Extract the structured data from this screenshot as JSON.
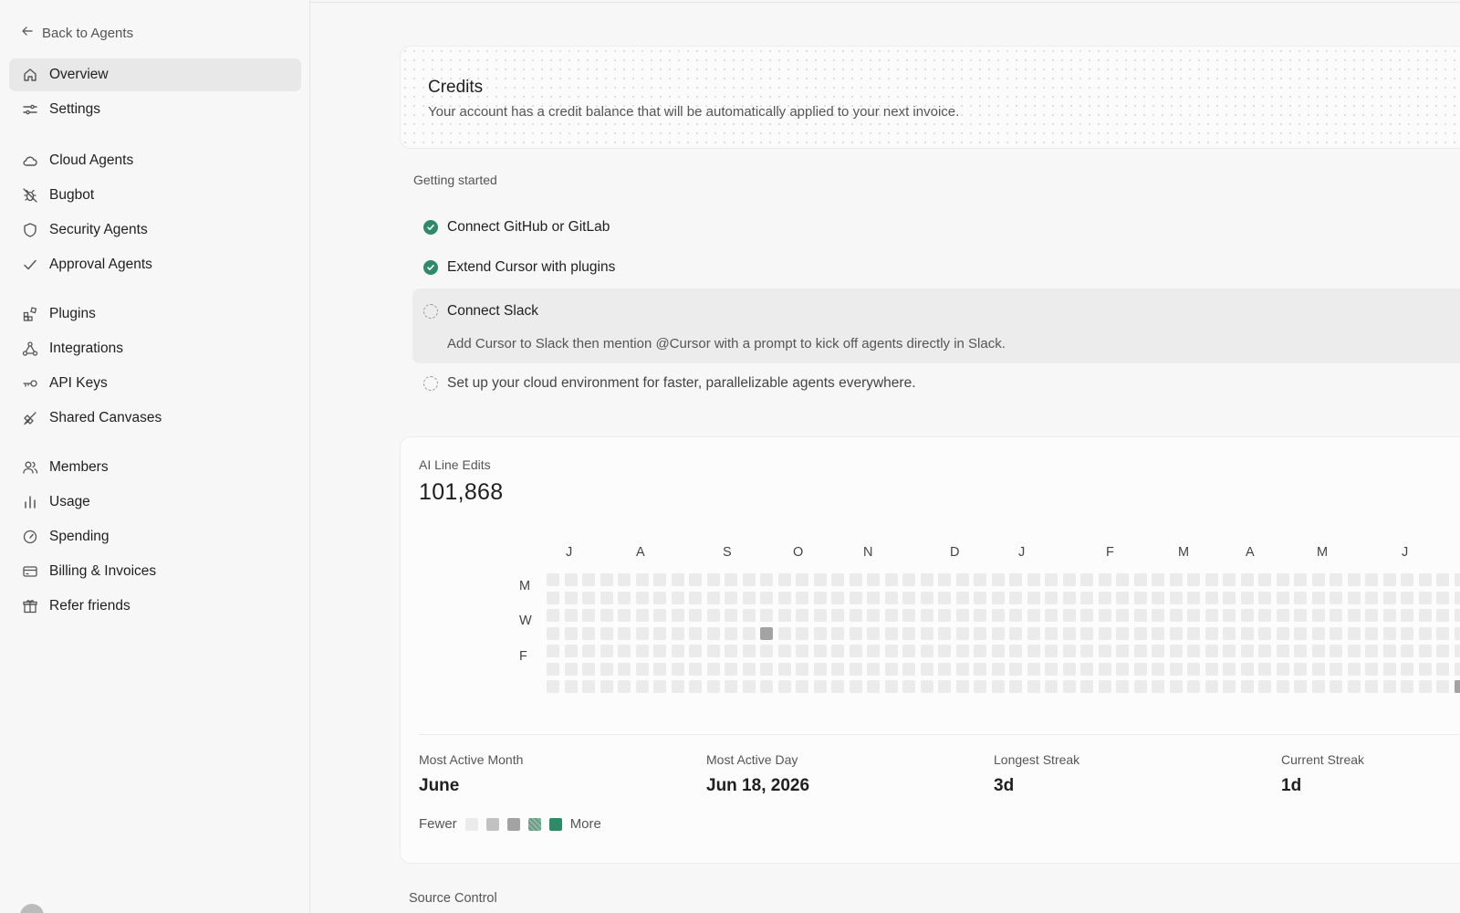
{
  "sidebar": {
    "back_label": "Back to Agents",
    "groups": [
      [
        {
          "label": "Overview",
          "icon": "home-icon",
          "active": true
        },
        {
          "label": "Settings",
          "icon": "sliders-icon"
        }
      ],
      [
        {
          "label": "Cloud Agents",
          "icon": "cloud-icon"
        },
        {
          "label": "Bugbot",
          "icon": "bug-off-icon"
        },
        {
          "label": "Security Agents",
          "icon": "shield-icon"
        },
        {
          "label": "Approval Agents",
          "icon": "check-icon"
        }
      ],
      [
        {
          "label": "Plugins",
          "icon": "plugin-blocks-icon"
        },
        {
          "label": "Integrations",
          "icon": "network-icon"
        },
        {
          "label": "API Keys",
          "icon": "key-icon"
        },
        {
          "label": "Shared Canvases",
          "icon": "brush-icon"
        }
      ],
      [
        {
          "label": "Members",
          "icon": "users-icon"
        },
        {
          "label": "Usage",
          "icon": "bar-chart-icon"
        },
        {
          "label": "Spending",
          "icon": "gauge-icon"
        },
        {
          "label": "Billing & Invoices",
          "icon": "credit-card-icon"
        },
        {
          "label": "Refer friends",
          "icon": "gift-icon"
        }
      ]
    ]
  },
  "credits": {
    "title": "Credits",
    "description": "Your account has a credit balance that will be automatically applied to your next invoice."
  },
  "getting_started": {
    "label": "Getting started",
    "items": [
      {
        "label": "Connect GitHub or GitLab",
        "done": true
      },
      {
        "label": "Extend Cursor with plugins",
        "done": true
      }
    ],
    "slack": {
      "label": "Connect Slack",
      "description": "Add Cursor to Slack then mention @Cursor with a prompt to kick off agents directly in Slack."
    },
    "cloud_env": "Set up your cloud environment for faster, parallelizable agents everywhere."
  },
  "ai_line_edits": {
    "label": "AI Line Edits",
    "value": "101,868",
    "months": [
      "J",
      "A",
      "S",
      "O",
      "N",
      "D",
      "J",
      "F",
      "M",
      "A",
      "M",
      "J"
    ],
    "days": [
      "M",
      "W",
      "F"
    ],
    "highlights": [
      {
        "week": 12,
        "day": 3,
        "level": 2
      },
      {
        "week": 51,
        "day": 6,
        "level": 2
      },
      {
        "week": 52,
        "day": 0,
        "level": 2
      },
      {
        "week": 52,
        "day": 1,
        "level": 2
      },
      {
        "week": 52,
        "day": 4,
        "level": 4
      }
    ],
    "stats": [
      {
        "label": "Most Active Month",
        "value": "June"
      },
      {
        "label": "Most Active Day",
        "value": "Jun 18, 2026"
      },
      {
        "label": "Longest Streak",
        "value": "3d"
      },
      {
        "label": "Current Streak",
        "value": "1d"
      }
    ],
    "legend": {
      "fewer": "Fewer",
      "more": "More",
      "colors": [
        "#ebebeb",
        "#c2c2c2",
        "#a3a3a3",
        "#6a9c85",
        "#2e8a68"
      ]
    }
  },
  "source_control": {
    "label": "Source Control"
  }
}
